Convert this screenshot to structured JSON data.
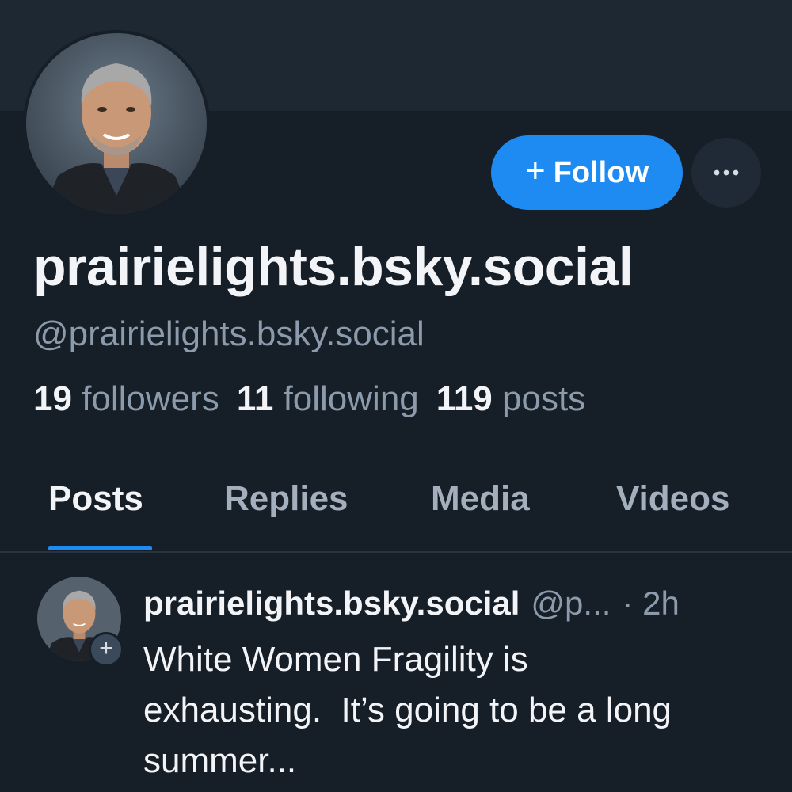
{
  "profile": {
    "display_name": "prairielights.bsky.social",
    "handle": "@prairielights.bsky.social",
    "avatar_icon": "profile-photo-man-gray-hair"
  },
  "actions": {
    "follow_label": "Follow",
    "follow_icon": "plus-icon",
    "more_icon": "ellipsis-icon"
  },
  "stats": {
    "followers_count": "19",
    "followers_label": "followers",
    "following_count": "11",
    "following_label": "following",
    "posts_count": "119",
    "posts_label": "posts"
  },
  "tabs": [
    {
      "label": "Posts",
      "active": true
    },
    {
      "label": "Replies",
      "active": false
    },
    {
      "label": "Media",
      "active": false
    },
    {
      "label": "Videos",
      "active": false
    }
  ],
  "feed": {
    "posts": [
      {
        "author": "prairielights.bsky.social",
        "handle": "@p...",
        "time": "· 2h",
        "text": "White Women Fragility is\nexhausting.  It’s going to be a long\nsummer..."
      }
    ]
  },
  "colors": {
    "background": "#161e27",
    "banner": "#1e2833",
    "accent": "#1d8bf2",
    "muted_text": "#8c9bab"
  }
}
